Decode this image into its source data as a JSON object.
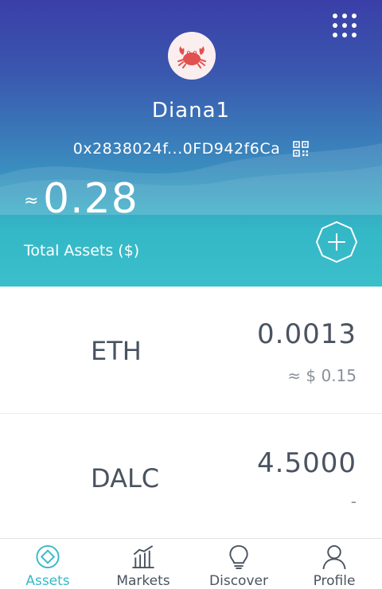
{
  "header": {
    "wallet_name": "Diana1",
    "address": "0x2838024f...0FD942f6Ca",
    "approx_symbol": "≈",
    "total_value": "0.28",
    "total_label": "Total Assets ($)"
  },
  "assets": [
    {
      "symbol": "ETH",
      "amount": "0.0013",
      "fiat": "≈ $ 0.15"
    },
    {
      "symbol": "DALC",
      "amount": "4.5000",
      "fiat": "-"
    }
  ],
  "tabs": [
    {
      "label": "Assets",
      "icon": "assets-icon",
      "active": true
    },
    {
      "label": "Markets",
      "icon": "markets-icon",
      "active": false
    },
    {
      "label": "Discover",
      "icon": "discover-icon",
      "active": false
    },
    {
      "label": "Profile",
      "icon": "profile-icon",
      "active": false
    }
  ],
  "colors": {
    "accent": "#36b9c9",
    "header_top": "#3a3fa8",
    "header_bottom": "#3bbfcb",
    "text": "#4a5360"
  }
}
